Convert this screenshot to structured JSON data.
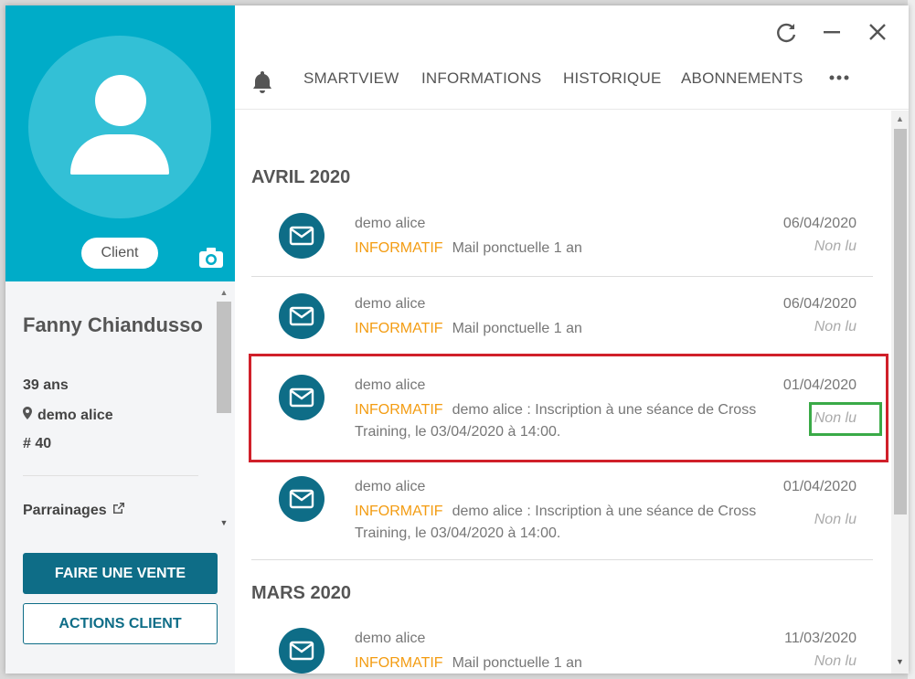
{
  "profile": {
    "badge": "Client",
    "name": "Fanny Chiandusso",
    "age": "39 ans",
    "location": "demo alice",
    "number": "# 40",
    "parrainages": "Parrainages"
  },
  "actions": {
    "sale_label": "FAIRE UNE VENTE",
    "client_actions_label": "ACTIONS CLIENT"
  },
  "tabs": [
    {
      "label": "SMARTVIEW"
    },
    {
      "label": "INFORMATIONS"
    },
    {
      "label": "HISTORIQUE"
    },
    {
      "label": "ABONNEMENTS"
    }
  ],
  "months": [
    {
      "label": "AVRIL 2020"
    },
    {
      "label": "MARS 2020"
    }
  ],
  "messages": [
    {
      "sender": "demo alice",
      "type": "INFORMATIF",
      "text": "Mail ponctuelle 1 an",
      "date": "06/04/2020",
      "status": "Non lu"
    },
    {
      "sender": "demo alice",
      "type": "INFORMATIF",
      "text": "Mail ponctuelle 1 an",
      "date": "06/04/2020",
      "status": "Non lu"
    },
    {
      "sender": "demo alice",
      "type": "INFORMATIF",
      "text": "demo alice : Inscription à une séance de Cross Training, le 03/04/2020 à 14:00.",
      "date": "01/04/2020",
      "status": "Non lu"
    },
    {
      "sender": "demo alice",
      "type": "INFORMATIF",
      "text": "demo alice : Inscription à une séance de Cross Training, le 03/04/2020 à 14:00.",
      "date": "01/04/2020",
      "status": "Non lu"
    },
    {
      "sender": "demo alice",
      "type": "INFORMATIF",
      "text": "Mail ponctuelle 1 an",
      "date": "11/03/2020",
      "status": "Non lu"
    }
  ],
  "colors": {
    "header_bg": "#00acc8",
    "primary": "#0e6d87",
    "type_orange": "#f39c12",
    "highlight_red": "#d0202a",
    "highlight_green": "#3aaa47"
  },
  "icons": [
    "user-avatar-icon",
    "camera-icon",
    "location-pin-icon",
    "external-link-icon",
    "bell-icon",
    "refresh-icon",
    "minimize-icon",
    "close-icon",
    "more-icon",
    "mail-icon"
  ]
}
